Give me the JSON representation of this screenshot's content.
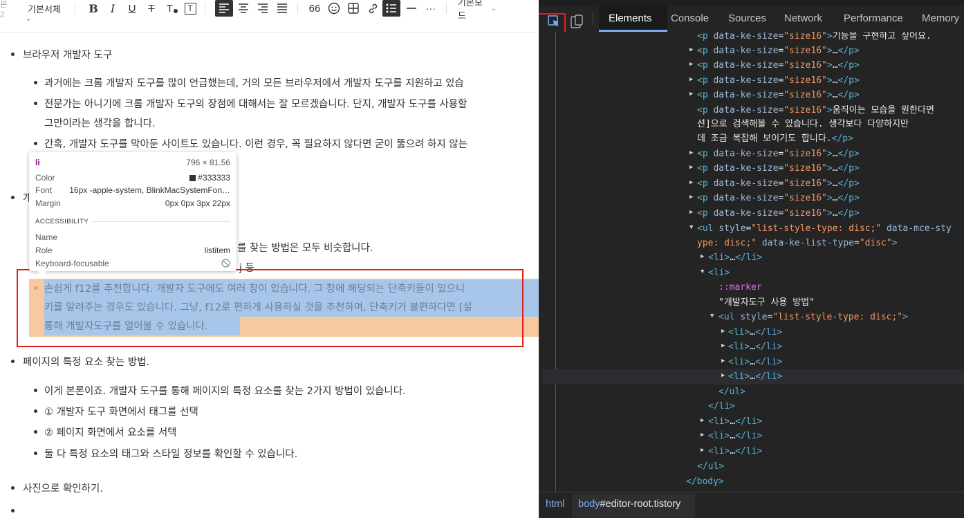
{
  "editor": {
    "toolbar": {
      "left_fragment": "본2",
      "font_label": "기본서체",
      "font_caret": "⌄",
      "bold": "B",
      "italic": "I",
      "underline": "U",
      "strike": "T",
      "text_color": "T",
      "text_bg": "T",
      "quote": "66",
      "more": "···",
      "mode_label": "기본모드",
      "mode_caret": "⌄"
    },
    "content": {
      "section1_title": "브라우저 개발자 도구",
      "s1_item1": "과거에는 크롬 개발자 도구를 많이 언급했는데, 거의 모든 브라우저에서 개발자 도구를 지원하고 있습",
      "s1_item2_line1": "전문가는 아니기에 크롬 개발자 도구의 장점에 대해서는 잘 모르겠습니다. 단지, 개발자 도구를 사용할",
      "s1_item2_line2": "그만이라는 생각을 합니다.",
      "s1_item3": "간혹, 개발자 도구를 막아둔 사이트도 있습니다. 이런 경우, 꼭 필요하지 않다면 굳이 뚫으려 하지 않는",
      "section2_fragment": "개",
      "s2_item1_fragment": "를 찾는 방법은 모두 비슷합니다.",
      "s2_item2_fragment": "j 등",
      "sel_line1": "손쉽게 f12를 추천합니다. 개발자 도구에도 여러 창이 있습니다. 그 창에 해당되는 단축키들이 있으니",
      "sel_line2": "키를 알려주는 경우도 있습니다. 그냥, f12로 편하게 사용하실 것을 추천하며, 단축키가 불편하다면 [설",
      "sel_line3": "통해 개발자도구를 열어볼 수 있습니다.",
      "section3_title": "페이지의 특정 요소 찾는 방법.",
      "s3_item1": "이게 본론이죠. 개발자 도구를 통해 페이지의 특정 요소를 찾는 2가지 방법이 있습니다.",
      "s3_item2": "① 개발자 도구 화면에서 태그를 선택",
      "s3_item3": "② 페이지 화면에서 요소를 서택",
      "s3_item4": "둘 다 특정 요소의 태그와 스타일 정보를 확인할 수 있습니다.",
      "section4_title": "사진으로 확인하기."
    },
    "tooltip": {
      "tag": "li",
      "size": "796 × 81.56",
      "color_label": "Color",
      "color_value": "#333333",
      "font_label": "Font",
      "font_value": "16px -apple-system, BlinkMacSystemFon…",
      "margin_label": "Margin",
      "margin_value": "0px 0px 3px 22px",
      "accessibility_heading": "ACCESSIBILITY",
      "name_label": "Name",
      "role_label": "Role",
      "role_value": "listitem",
      "keyboard_label": "Keyboard-focusable"
    }
  },
  "devtools": {
    "tabs": [
      "Elements",
      "Console",
      "Sources",
      "Network",
      "Performance",
      "Memory"
    ],
    "active_tab": "Elements",
    "dom": {
      "p_tag": "p",
      "attr_name": "data-ke-size",
      "attr_value": "\"size16\"",
      "p1_text": "기능을 구현하고 싶어요.",
      "ellipsis": "…",
      "p_close": "</p>",
      "p_long_text1": "움직이는 모습을 원한다면",
      "p_long_text2": "션]으로 검색해볼 수 있습니다. 생각보다 다양하지만",
      "p_long_text3": "데 조금 복잡해 보이기도 합니다.",
      "ul_tag": "ul",
      "ul_style_attr": "style",
      "ul_style_val": "\"list-style-type: disc;\"",
      "ul_mce_attr": "data-mce-sty",
      "ul_line2_val": "ype: disc;\"",
      "ul_list_attr": "data-ke-list-type",
      "ul_list_val": "\"disc\"",
      "li_tag": "li",
      "marker": "::marker",
      "li_text": "\"개발자도구 사용 방법\"",
      "ul_close": "</ul>",
      "li_close": "</li>",
      "body_close": "</body>"
    },
    "breadcrumbs": {
      "html": "html",
      "body_tag": "body",
      "body_id": "#editor-root.tistory"
    }
  },
  "colors": {
    "selection_blue": "#a7c6ea",
    "margin_orange": "#f6c9a0",
    "highlight_red": "#e02020",
    "devtools_bg": "#242424",
    "tag_blue": "#5db0d7",
    "attr_value_orange": "#f29766"
  }
}
